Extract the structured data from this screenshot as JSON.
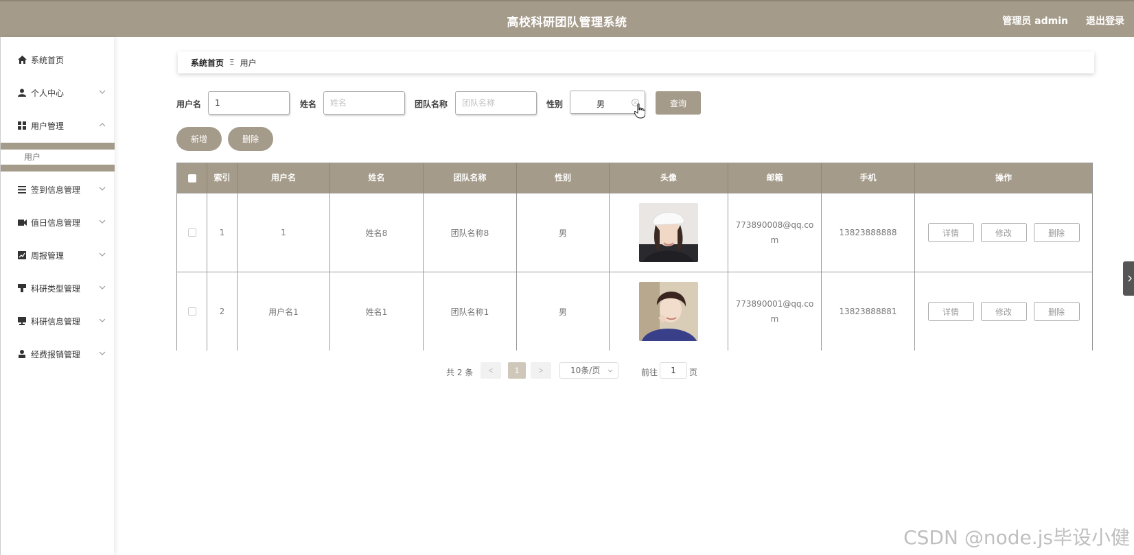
{
  "header": {
    "title": "高校科研团队管理系统",
    "user": "管理员 admin",
    "logout": "退出登录"
  },
  "sidebar": {
    "items": [
      {
        "label": "系统首页",
        "icon": "home-icon"
      },
      {
        "label": "个人中心",
        "icon": "user-icon"
      },
      {
        "label": "用户管理",
        "icon": "grid-icon"
      },
      {
        "label": "签到信息管理",
        "icon": "list-icon"
      },
      {
        "label": "值日信息管理",
        "icon": "film-icon"
      },
      {
        "label": "周报管理",
        "icon": "chart-icon"
      },
      {
        "label": "科研类型管理",
        "icon": "pin-icon"
      },
      {
        "label": "科研信息管理",
        "icon": "monitor-icon"
      },
      {
        "label": "经费报销管理",
        "icon": "person-icon"
      }
    ],
    "submenu": {
      "label": "用户"
    }
  },
  "breadcrumb": {
    "home": "系统首页",
    "separator": "Ξ",
    "current": "用户"
  },
  "search": {
    "username_label": "用户名",
    "username_value": "1",
    "name_label": "姓名",
    "name_placeholder": "姓名",
    "team_label": "团队名称",
    "team_placeholder": "团队名称",
    "gender_label": "性别",
    "gender_value": "男",
    "query_button": "查询"
  },
  "actions": {
    "add": "新增",
    "delete": "删除"
  },
  "table": {
    "columns": [
      "索引",
      "用户名",
      "姓名",
      "团队名称",
      "性别",
      "头像",
      "邮箱",
      "手机",
      "操作"
    ],
    "rows": [
      {
        "index": "1",
        "username": "1",
        "name": "姓名8",
        "team": "团队名称8",
        "gender": "男",
        "email": "773890008@qq.com",
        "phone": "13823888888"
      },
      {
        "index": "2",
        "username": "用户名1",
        "name": "姓名1",
        "team": "团队名称1",
        "gender": "男",
        "email": "773890001@qq.com",
        "phone": "13823888881"
      }
    ],
    "op_buttons": [
      "详情",
      "修改",
      "删除"
    ]
  },
  "pagination": {
    "total": "共 2 条",
    "prev": "<",
    "current": "1",
    "next": ">",
    "page_size": "10条/页",
    "goto_label": "前往",
    "goto_value": "1",
    "page_suffix": "页"
  },
  "watermark": "CSDN @node.js毕设小健",
  "colors": {
    "accent": "#a59b8a",
    "accent_dark": "#8e8573"
  }
}
